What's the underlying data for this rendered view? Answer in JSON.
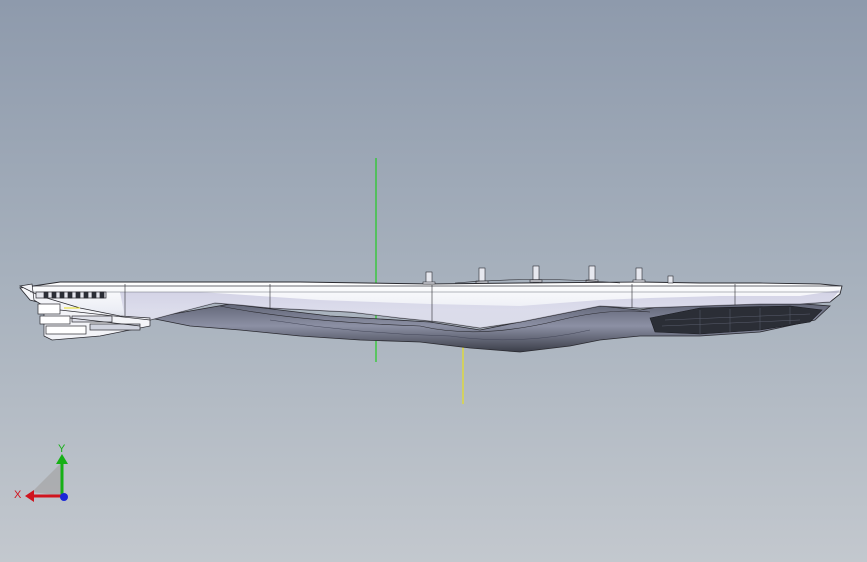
{
  "viewport": {
    "background_top": "#8e9aac",
    "background_bottom": "#c3c8ce"
  },
  "model": {
    "body_color": "#eef0f6",
    "shadow_color": "#6e7487",
    "dark_color": "#2b2e36",
    "edge_color": "#2a2a30"
  },
  "axes": {
    "x_label": "X",
    "y_label": "Y",
    "x_color": "#d0141e",
    "y_color": "#16b016",
    "z_color": "#1a28d8",
    "vertical_green_color": "#22cc22",
    "vertical_yellow_color": "#e8e020"
  }
}
